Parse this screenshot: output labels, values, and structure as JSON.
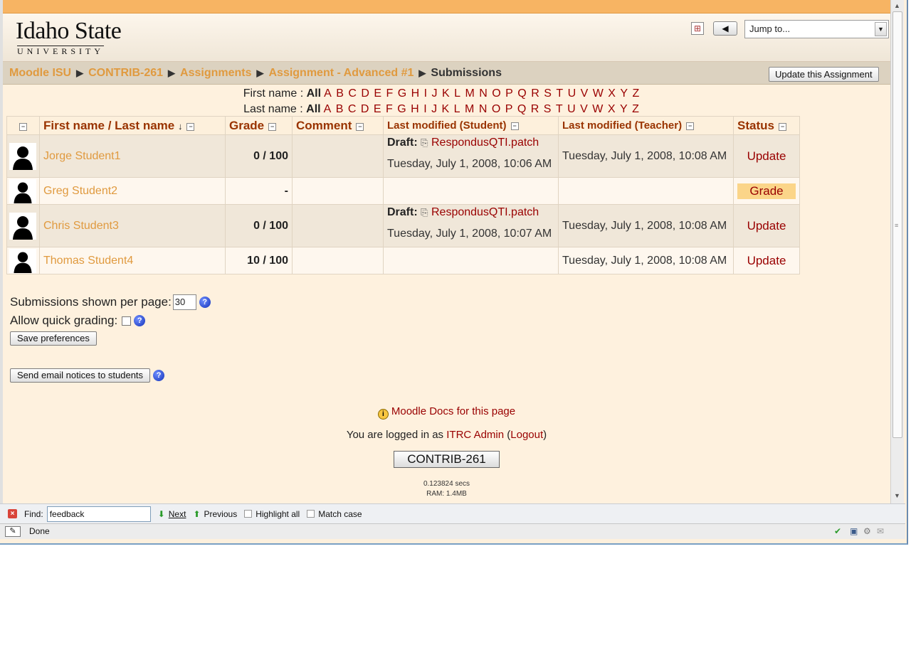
{
  "header": {
    "logo_line1": "Idaho State",
    "logo_line2": "UNIVERSITY",
    "back_arrow": "◀",
    "jump_select": "Jump to..."
  },
  "breadcrumb": {
    "items": [
      "Moodle ISU",
      "CONTRIB-261",
      "Assignments",
      "Assignment - Advanced #1"
    ],
    "current": "Submissions",
    "separator": "▶"
  },
  "update_assignment_button": "Update this Assignment",
  "filters": {
    "first_label": "First name :",
    "last_label": "Last name :",
    "all": "All",
    "letters": [
      "A",
      "B",
      "C",
      "D",
      "E",
      "F",
      "G",
      "H",
      "I",
      "J",
      "K",
      "L",
      "M",
      "N",
      "O",
      "P",
      "Q",
      "R",
      "S",
      "T",
      "U",
      "V",
      "W",
      "X",
      "Y",
      "Z"
    ]
  },
  "table": {
    "headers": {
      "name": "First name / Last name",
      "name_sort": "↓",
      "grade": "Grade",
      "comment": "Comment",
      "last_student": "Last modified (Student)",
      "last_teacher": "Last modified (Teacher)",
      "status": "Status"
    },
    "rows": [
      {
        "name": "Jorge Student1",
        "grade": "0 / 100",
        "draft_label": "Draft:",
        "file": "RespondusQTI.patch",
        "student_time": "Tuesday, July 1, 2008, 10:06 AM",
        "teacher_time": "Tuesday, July 1, 2008, 10:08 AM",
        "status": "Update"
      },
      {
        "name": "Greg Student2",
        "grade": "-",
        "draft_label": "",
        "file": "",
        "student_time": "",
        "teacher_time": "",
        "status": "Grade"
      },
      {
        "name": "Chris Student3",
        "grade": "0 / 100",
        "draft_label": "Draft:",
        "file": "RespondusQTI.patch",
        "student_time": "Tuesday, July 1, 2008, 10:07 AM",
        "teacher_time": "Tuesday, July 1, 2008, 10:08 AM",
        "status": "Update"
      },
      {
        "name": "Thomas Student4",
        "grade": "10 / 100",
        "draft_label": "",
        "file": "",
        "student_time": "",
        "teacher_time": "Tuesday, July 1, 2008, 10:08 AM",
        "status": "Update"
      }
    ]
  },
  "prefs": {
    "per_page_label": "Submissions shown per page:",
    "per_page_value": "30",
    "quick_grading_label": "Allow quick grading:",
    "save_button": "Save preferences",
    "email_button": "Send email notices to students"
  },
  "footer": {
    "docs_link": "Moodle Docs for this page",
    "logged_prefix": "You are logged in as",
    "user": "ITRC Admin",
    "logout": "Logout",
    "course_button": "CONTRIB-261",
    "perf_line1": "0.123824 secs",
    "perf_line2": "RAM: 1.4MB"
  },
  "findbar": {
    "label": "Find:",
    "value": "feedback",
    "next": "Next",
    "previous": "Previous",
    "highlight": "Highlight all",
    "match_case": "Match case"
  },
  "statusbar": {
    "text": "Done"
  }
}
